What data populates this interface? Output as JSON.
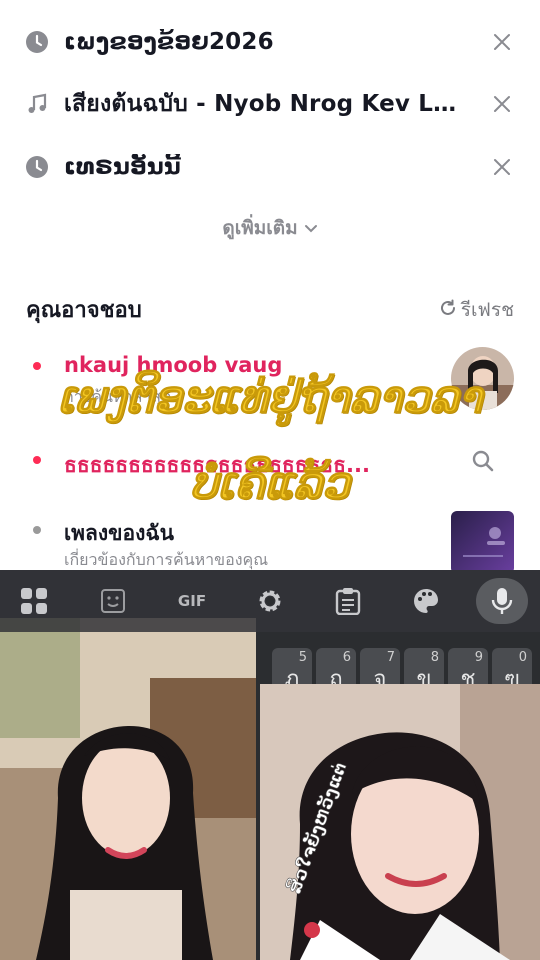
{
  "history": [
    {
      "icon": "clock-icon",
      "text": "ເພງຂອງຂ້ອຍ2026"
    },
    {
      "icon": "music-note-icon",
      "text": "เสียงต้นฉบับ - Nyob Nrog Kev Lwj..."
    },
    {
      "icon": "clock-icon",
      "text": "ເທຣນອັນນີ້"
    }
  ],
  "see_more": {
    "label": "ดูเพิ่มเติม"
  },
  "suggestions_section": {
    "title": "คุณอาจชอบ",
    "refresh_label": "รีเฟรช"
  },
  "suggestions": [
    {
      "title": "nkauj hmoob vaug",
      "subtitle": "การค้นหาล่าสุด",
      "dot_color": "#fe2c55",
      "title_color": "#e0245e"
    },
    {
      "title": "ธธธธธธธธธธธธธธธธธธธธธธ...",
      "subtitle": "",
      "dot_color": "#fe2c55",
      "title_color": "#e0245e"
    },
    {
      "title": "เพลงของฉัน",
      "subtitle": "เกี่ยวข้องกับการค้นหาของคุณ",
      "dot_color": "#9a9a9a",
      "title_color": "#161823"
    }
  ],
  "overlay_caption": {
    "line1": "ເພງຕິອະແທ່ຢູ່ຖ້າລາວລາ",
    "line2": "ບໍ່ເຄີແລ້ວ"
  },
  "keyboard": {
    "toolbar": [
      {
        "icon": "apps-grid-icon"
      },
      {
        "icon": "sticker-icon"
      },
      {
        "icon": "gif-icon",
        "label": "GIF"
      },
      {
        "icon": "gear-icon"
      },
      {
        "icon": "clipboard-icon"
      },
      {
        "icon": "palette-icon"
      },
      {
        "icon": "microphone-icon"
      }
    ],
    "keys": [
      {
        "num": "5",
        "char": "ภ"
      },
      {
        "num": "6",
        "char": "ถ"
      },
      {
        "num": "7",
        "char": "จ"
      },
      {
        "num": "8",
        "char": "ข"
      },
      {
        "num": "9",
        "char": "ช"
      },
      {
        "num": "0",
        "char": "ฃ"
      }
    ]
  },
  "video_caption": "ສິວໃຈຍັງຫວັງແຕ່",
  "colors": {
    "accent": "#fe2c55",
    "caption_yellow": "#f3c623",
    "muted": "#8a8b91"
  }
}
